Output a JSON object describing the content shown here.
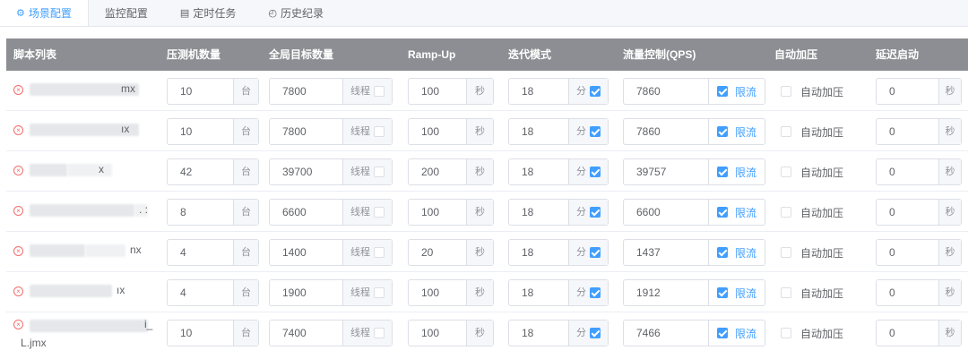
{
  "tabs": [
    {
      "label": "场景配置",
      "icon": "gear-icon",
      "active": true
    },
    {
      "label": "监控配置",
      "icon": "",
      "active": false
    },
    {
      "label": "定时任务",
      "icon": "calendar-icon",
      "active": false
    },
    {
      "label": "历史纪录",
      "icon": "history-icon",
      "active": false
    }
  ],
  "columns": [
    "脚本列表",
    "压测机数量",
    "全局目标数量",
    "Ramp-Up",
    "迭代模式",
    "流量控制(QPS)",
    "自动加压",
    "延迟启动"
  ],
  "units": {
    "machine": "台",
    "thread": "线程",
    "second": "秒",
    "minute": "分",
    "limit": "限流",
    "auto": "自动加压"
  },
  "rows": [
    {
      "script_visible": "mx",
      "script_line2": "",
      "machines": "10",
      "target": "7800",
      "rampup": "100",
      "iterate": "18",
      "qps": "7860",
      "delay": "0"
    },
    {
      "script_visible": "ıx",
      "script_line2": "",
      "machines": "10",
      "target": "7800",
      "rampup": "100",
      "iterate": "18",
      "qps": "7860",
      "delay": "0"
    },
    {
      "script_visible": "x",
      "script_line2": "",
      "machines": "42",
      "target": "39700",
      "rampup": "200",
      "iterate": "18",
      "qps": "39757",
      "delay": "0"
    },
    {
      "script_visible": ". :",
      "script_line2": "",
      "machines": "8",
      "target": "6600",
      "rampup": "100",
      "iterate": "18",
      "qps": "6600",
      "delay": "0"
    },
    {
      "script_visible": "nx",
      "script_line2": "",
      "machines": "4",
      "target": "1400",
      "rampup": "20",
      "iterate": "18",
      "qps": "1437",
      "delay": "0"
    },
    {
      "script_visible": "ıx",
      "script_line2": "",
      "machines": "4",
      "target": "1900",
      "rampup": "100",
      "iterate": "18",
      "qps": "1912",
      "delay": "0"
    },
    {
      "script_visible": "i_",
      "script_line2": "L.jmx",
      "machines": "10",
      "target": "7400",
      "rampup": "100",
      "iterate": "18",
      "qps": "7466",
      "delay": "0"
    }
  ],
  "colors": {
    "accent": "#409eff",
    "header": "#8c8e93",
    "danger": "#f56c6c"
  }
}
